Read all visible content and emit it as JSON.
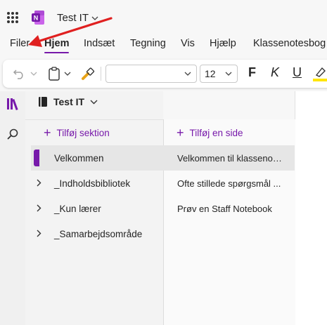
{
  "titlebar": {
    "app_icon": "waffle-icon",
    "notebook_name": "Test IT",
    "brand_color": "#7719aa"
  },
  "menu": {
    "tabs": [
      {
        "label": "Filer"
      },
      {
        "label": "Hjem"
      },
      {
        "label": "Indsæt"
      },
      {
        "label": "Tegning"
      },
      {
        "label": "Vis"
      },
      {
        "label": "Hjælp"
      },
      {
        "label": "Klassenotesbog"
      }
    ],
    "active": "Hjem"
  },
  "toolbar": {
    "font_name": "",
    "font_size": "12",
    "bold": "F",
    "italic": "K",
    "underline": "U"
  },
  "notebook": {
    "name": "Test IT",
    "add_section": "Tilføj sektion",
    "add_page": "Tilføj en side",
    "sections": [
      {
        "label": "Velkommen",
        "selected": true
      },
      {
        "label": "_Indholdsbibliotek"
      },
      {
        "label": "_Kun lærer"
      },
      {
        "label": "_Samarbejdsområde"
      }
    ],
    "pages": [
      {
        "label": "Velkommen til klassenot...",
        "selected": true
      },
      {
        "label": "Ofte stillede spørgsmål ..."
      },
      {
        "label": "Prøv en Staff Notebook"
      }
    ]
  },
  "annotation": {
    "arrow_color": "#e02020"
  }
}
